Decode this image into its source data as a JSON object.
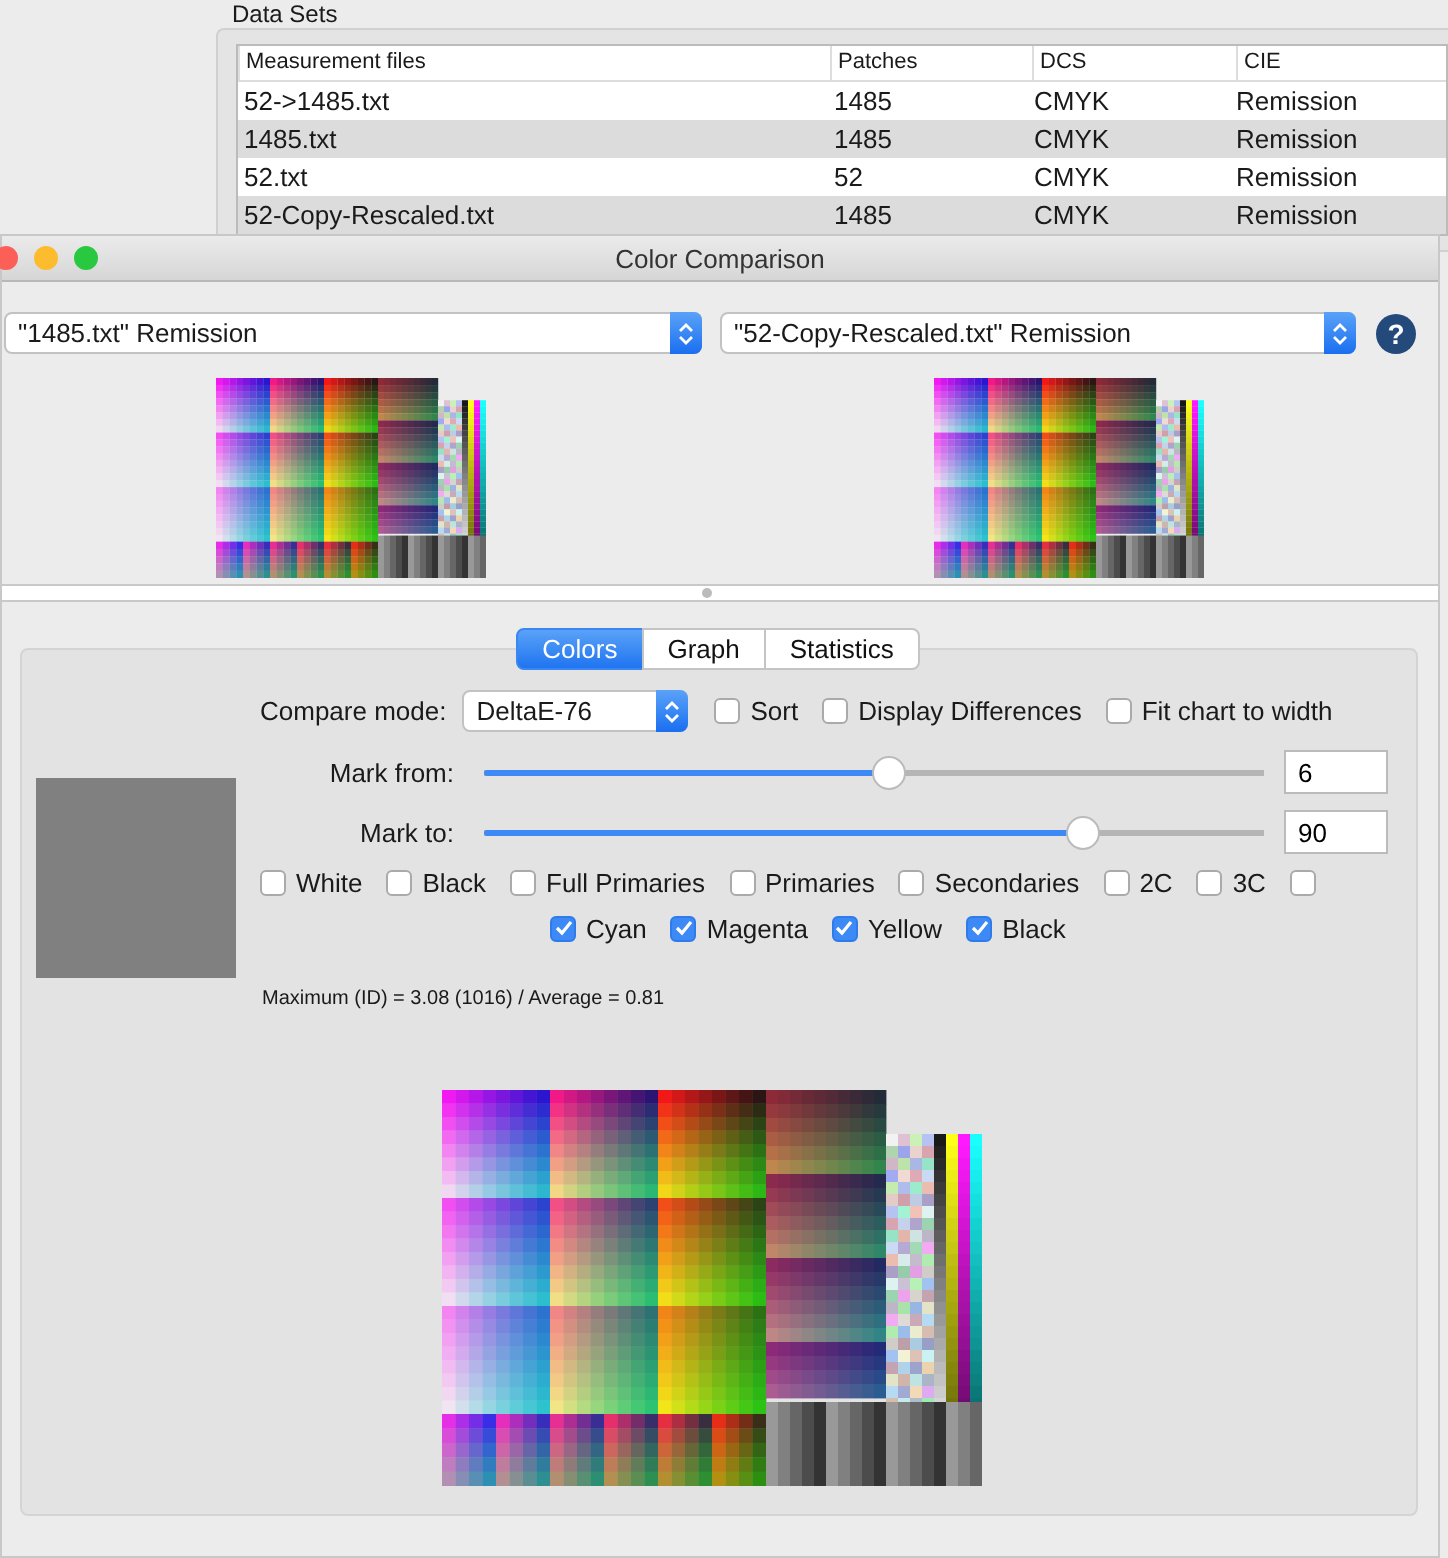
{
  "background_window": {
    "group_label": "Data Sets",
    "table": {
      "columns": [
        "Measurement files",
        "Patches",
        "DCS",
        "CIE"
      ],
      "rows": [
        {
          "cells": [
            "52->1485.txt",
            "1485",
            "CMYK",
            "Remission"
          ]
        },
        {
          "cells": [
            "1485.txt",
            "1485",
            "CMYK",
            "Remission"
          ]
        },
        {
          "cells": [
            "52.txt",
            "52",
            "CMYK",
            "Remission"
          ]
        },
        {
          "cells": [
            "52-Copy-Rescaled.txt",
            "1485",
            "CMYK",
            "Remission"
          ]
        }
      ]
    }
  },
  "window": {
    "title": "Color Comparison"
  },
  "sources": [
    {
      "value": "\"1485.txt\" Remission"
    },
    {
      "value": "\"52-Copy-Rescaled.txt\" Remission"
    }
  ],
  "help_button": "?",
  "tabs": [
    {
      "label": "Colors",
      "selected": true
    },
    {
      "label": "Graph",
      "selected": false
    },
    {
      "label": "Statistics",
      "selected": false
    }
  ],
  "compare_mode": {
    "label": "Compare mode:",
    "value": "DeltaE-76"
  },
  "options": [
    {
      "label": "Sort",
      "checked": false
    },
    {
      "label": "Display Differences",
      "checked": false
    },
    {
      "label": "Fit chart to width",
      "checked": false
    }
  ],
  "sliders": [
    {
      "label": "Mark from:",
      "level": 0.52,
      "value": "6"
    },
    {
      "label": "Mark to:",
      "level": 0.77,
      "value": "90"
    }
  ],
  "patch_filters": [
    {
      "label": "White",
      "checked": false
    },
    {
      "label": "Black",
      "checked": false
    },
    {
      "label": "Full Primaries",
      "checked": false
    },
    {
      "label": "Primaries",
      "checked": false
    },
    {
      "label": "Secondaries",
      "checked": false
    },
    {
      "label": "2C",
      "checked": false
    },
    {
      "label": "3C",
      "checked": false
    },
    {
      "checked": false
    }
  ],
  "channel_filters": [
    {
      "label": "Cyan",
      "checked": true
    },
    {
      "label": "Magenta",
      "checked": true
    },
    {
      "label": "Yellow",
      "checked": true
    },
    {
      "label": "Black",
      "checked": true
    }
  ],
  "statistics": "Maximum (ID) = 3.08 (1016) / Average = 0.81"
}
